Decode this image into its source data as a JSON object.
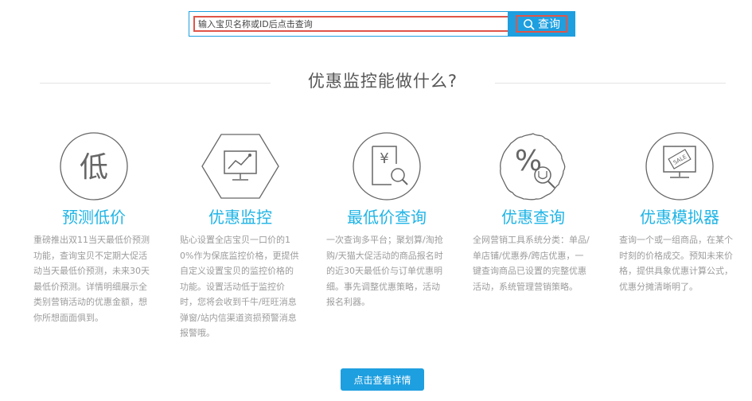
{
  "search": {
    "placeholder": "输入宝贝名称或ID后点击查询",
    "button_label": "查询"
  },
  "section": {
    "heading": "优惠监控能做什么?"
  },
  "features": [
    {
      "icon": "low-price-icon",
      "icon_char": "低",
      "title": "预测低价",
      "description": "重磅推出双11当天最低价预测功能，查询宝贝不定期大促活动当天最低价预测，未来30天最低价预测。详情明细展示全类别营销活动的优惠金额，想你所想面面俱到。"
    },
    {
      "icon": "monitor-chart-icon",
      "title": "优惠监控",
      "description": "贴心设置全店宝贝一口价的10%作为保底监控价格，更提供自定义设置宝贝的监控价格的功能。设置活动低于监控价时，您将会收到千牛/旺旺消息弹窗/站内信渠道资损预警消息报警哦。"
    },
    {
      "icon": "yen-search-icon",
      "icon_char": "¥",
      "title": "最低价查询",
      "description": "一次查询多平台；聚划算/淘抢购/天猫大促活动的商品报名时的近30天最低价与订单优惠明细。事先调整优惠策略，活动报名利器。"
    },
    {
      "icon": "discount-search-icon",
      "icon_char": "%",
      "title": "优惠查询",
      "description": "全网营销工具系统分类：单品/单店铺/优惠券/跨店优惠，一键查询商品已设置的完整优惠活动，系统管理营销策略。"
    },
    {
      "icon": "sale-tag-icon",
      "icon_char": "SALE",
      "title": "优惠模拟器",
      "description": "查询一个或一组商品，在某个时刻的价格成交。预知未来价格，提供具象优惠计算公式，优惠分摊清晰明了。"
    }
  ],
  "details_button": {
    "label": "点击查看详情"
  },
  "colors": {
    "accent": "#1e9fe0",
    "title": "#1fb4e6",
    "highlight_border": "#e05548",
    "icon_stroke": "#666666"
  }
}
